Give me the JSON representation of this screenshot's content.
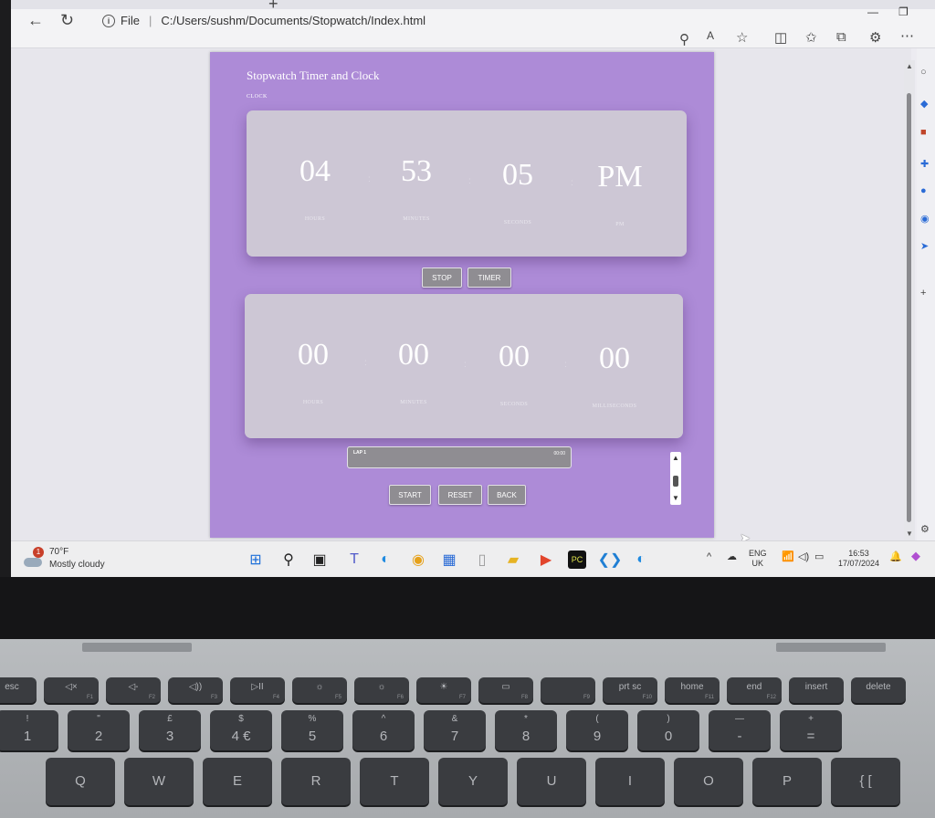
{
  "browser": {
    "url_prefix": "File",
    "url": "C:/Users/sushm/Documents/Stopwatch/Index.html",
    "new_tab_icon": "+",
    "minimize_icon": "—",
    "restore_icon": "❐"
  },
  "app": {
    "title": "Stopwatch Timer and Clock",
    "section_label": "CLOCK",
    "clock": [
      {
        "value": "04",
        "label": "HOURS"
      },
      {
        "value": "53",
        "label": "MINUTES"
      },
      {
        "value": "05",
        "label": "SECONDS"
      },
      {
        "value": "PM",
        "label": "PM"
      }
    ],
    "clock_buttons": {
      "stop": "STOP",
      "timer": "TIMER"
    },
    "stopwatch": [
      {
        "value": "00",
        "label": "HOURS"
      },
      {
        "value": "00",
        "label": "MINUTES"
      },
      {
        "value": "00",
        "label": "SECONDS"
      },
      {
        "value": "00",
        "label": "MILLISECONDS"
      }
    ],
    "laps": [
      {
        "name": "LAP 1",
        "time": "00:00"
      }
    ],
    "buttons": {
      "start": "START",
      "reset": "RESET",
      "back": "BACK"
    }
  },
  "taskbar": {
    "weather": {
      "temp": "70°F",
      "desc": "Mostly cloudy",
      "badge": "1"
    },
    "lang": "ENG",
    "region": "UK",
    "time": "16:53",
    "date": "17/07/2024"
  },
  "keyboard": {
    "row_f": [
      {
        "main": "esc",
        "sub": ""
      },
      {
        "main": "◁×",
        "sub": "F1"
      },
      {
        "main": "◁-",
        "sub": "F2"
      },
      {
        "main": "◁))",
        "sub": "F3"
      },
      {
        "main": "▷II",
        "sub": "F4"
      },
      {
        "main": "☼",
        "sub": "F5"
      },
      {
        "main": "☼",
        "sub": "F6"
      },
      {
        "main": "☀",
        "sub": "F7"
      },
      {
        "main": "▭",
        "sub": "F8"
      },
      {
        "main": "",
        "sub": "F9"
      },
      {
        "main": "prt sc",
        "sub": "F10"
      },
      {
        "main": "home",
        "sub": "F11"
      },
      {
        "main": "end",
        "sub": "F12"
      },
      {
        "main": "insert",
        "sub": ""
      },
      {
        "main": "delete",
        "sub": ""
      }
    ],
    "row_num": [
      {
        "top": "!",
        "main": "1"
      },
      {
        "top": "\"",
        "main": "2"
      },
      {
        "top": "£",
        "main": "3"
      },
      {
        "top": "$",
        "main": "4 €"
      },
      {
        "top": "%",
        "main": "5"
      },
      {
        "top": "^",
        "main": "6"
      },
      {
        "top": "&",
        "main": "7"
      },
      {
        "top": "*",
        "main": "8"
      },
      {
        "top": "(",
        "main": "9"
      },
      {
        "top": ")",
        "main": "0"
      },
      {
        "top": "—",
        "main": "-"
      },
      {
        "top": "+",
        "main": "="
      }
    ],
    "row_q": [
      "Q",
      "W",
      "E",
      "R",
      "T",
      "Y",
      "U",
      "I",
      "O",
      "P",
      "{ ["
    ]
  },
  "colors": {
    "app_bg": "#ad8bd7",
    "card_bg": "#cecad4",
    "button_bg": "#8f8d92"
  }
}
